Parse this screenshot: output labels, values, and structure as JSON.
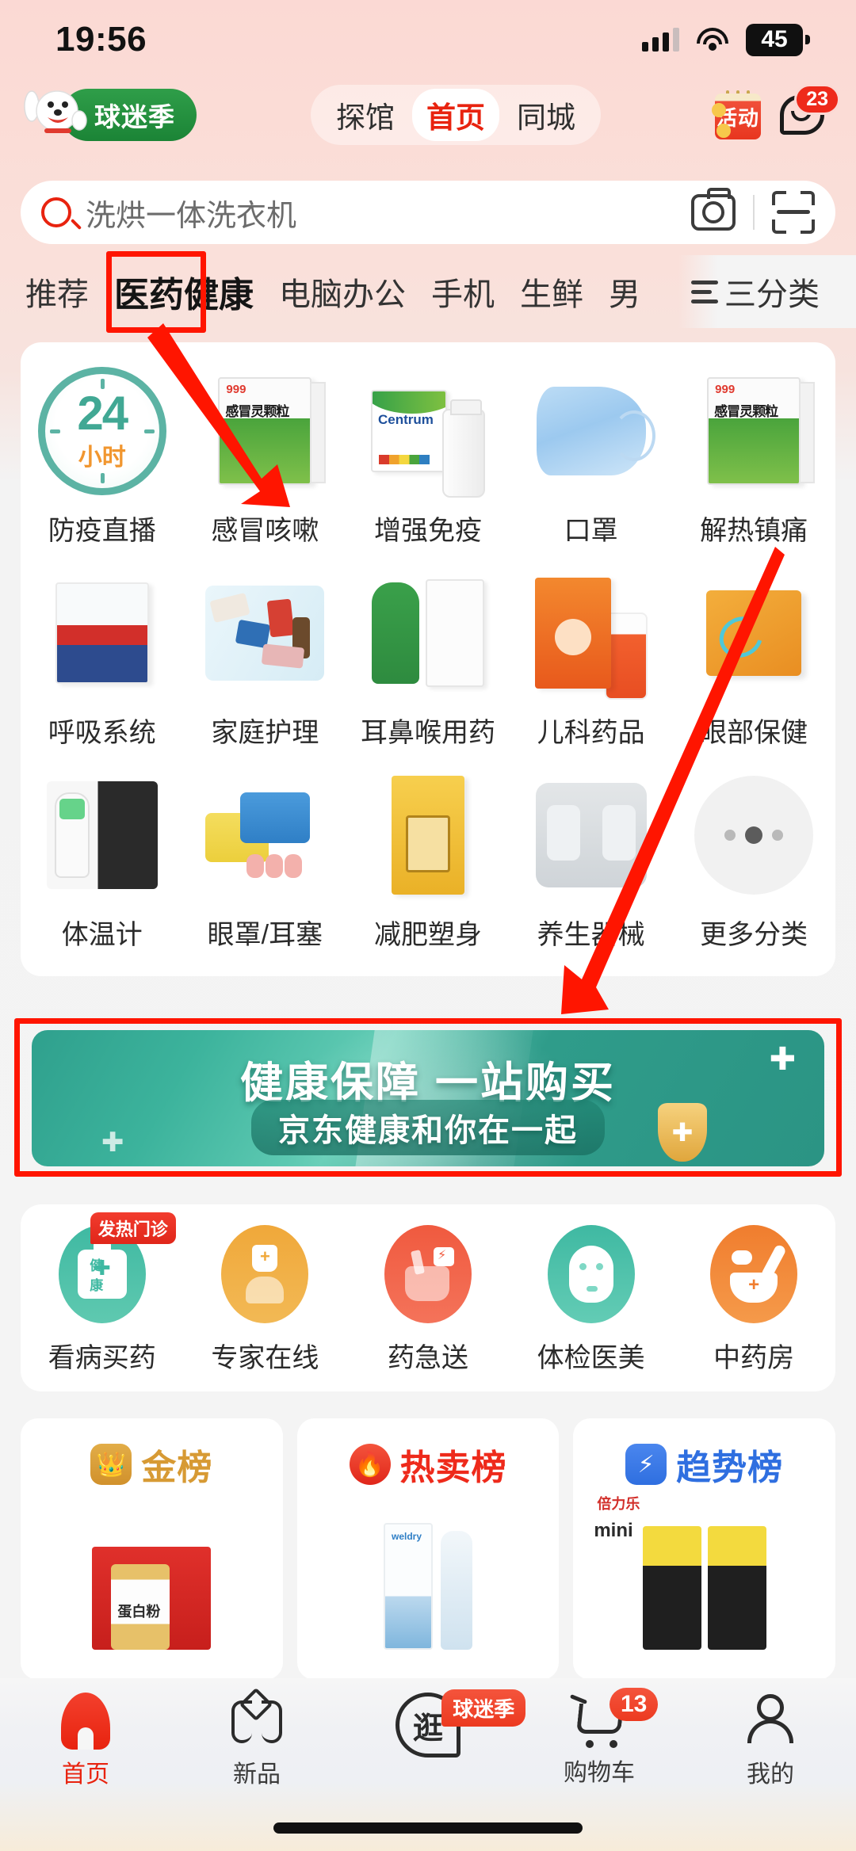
{
  "status_bar": {
    "time": "19:56",
    "battery": "45",
    "wifi_icon": "wifi-icon",
    "signal_icon": "signal-bars-icon"
  },
  "header": {
    "logo_text": "球迷季",
    "logo_icon": "jd-dog-mascot-icon",
    "tabs": [
      {
        "label": "探馆",
        "active": false
      },
      {
        "label": "首页",
        "active": true
      },
      {
        "label": "同城",
        "active": false
      }
    ],
    "activity_icon_label": "活动",
    "message_icon": "message-bubble-icon",
    "message_badge": "23"
  },
  "search": {
    "value": "洗烘一体洗衣机",
    "placeholder": "洗烘一体洗衣机",
    "search_icon": "search-icon",
    "camera_icon": "camera-icon",
    "scan_icon": "scan-barcode-icon"
  },
  "category_tabs": {
    "items": [
      {
        "label": "推荐",
        "selected": false
      },
      {
        "label": "医药健康",
        "selected": true
      },
      {
        "label": "电脑办公",
        "selected": false
      },
      {
        "label": "手机",
        "selected": false
      },
      {
        "label": "生鲜",
        "selected": false
      },
      {
        "label": "男",
        "selected": false
      }
    ],
    "menu_label": "三分类",
    "menu_icon": "hamburger-menu-icon"
  },
  "icon_grid": {
    "rows": [
      [
        {
          "label": "防疫直播",
          "art": "clock24"
        },
        {
          "label": "感冒咳嗽",
          "art": "box999"
        },
        {
          "label": "增强免疫",
          "art": "centrum"
        },
        {
          "label": "口罩",
          "art": "mask"
        },
        {
          "label": "解热镇痛",
          "art": "box999b"
        }
      ],
      [
        {
          "label": "呼吸系统",
          "art": "boxTeal"
        },
        {
          "label": "家庭护理",
          "art": "kit"
        },
        {
          "label": "耳鼻喉用药",
          "art": "spray"
        },
        {
          "label": "儿科药品",
          "art": "syrup"
        },
        {
          "label": "眼部保健",
          "art": "goldBox"
        }
      ],
      [
        {
          "label": "体温计",
          "art": "thermo"
        },
        {
          "label": "眼罩/耳塞",
          "art": "earplug"
        },
        {
          "label": "减肥塑身",
          "art": "yellowBox"
        },
        {
          "label": "养生器械",
          "art": "brace"
        },
        {
          "label": "更多分类",
          "art": "moreDots"
        }
      ]
    ]
  },
  "banner": {
    "line1": "健康保障 一站购买",
    "line2": "京东健康和你在一起",
    "plus_icon": "medical-cross-icon",
    "shield_icon": "gold-shield-icon",
    "bg_color": "#2f9c8a"
  },
  "services": [
    {
      "label": "看病买药",
      "badge": "发热门诊",
      "color": "#3fb9a2",
      "icon": "health-bag-icon"
    },
    {
      "label": "专家在线",
      "badge": "",
      "color": "#f0a83a",
      "icon": "doctor-icon"
    },
    {
      "label": "药急送",
      "badge": "",
      "color": "#f05a3f",
      "icon": "fast-delivery-flask-icon"
    },
    {
      "label": "体检医美",
      "badge": "",
      "color": "#3fb9a2",
      "icon": "face-mask-icon"
    },
    {
      "label": "中药房",
      "badge": "",
      "color": "#f07d2e",
      "icon": "mortar-pestle-icon"
    }
  ],
  "rank_cards": [
    {
      "title": "金榜",
      "badge_icon": "crown-badge-icon",
      "color": "#d79a34",
      "product": "蛋白粉礼盒"
    },
    {
      "title": "热卖榜",
      "badge_icon": "flame-badge-icon",
      "color": "#ee2a1b",
      "product": "便携式氧气呼吸器"
    },
    {
      "title": "趋势榜",
      "badge_icon": "lightning-badge-icon",
      "color": "#2f6fe0",
      "product": "mini 倍力乐"
    }
  ],
  "bottom_nav": [
    {
      "label": "首页",
      "active": true,
      "icon": "home-icon",
      "badge": ""
    },
    {
      "label": "新品",
      "active": false,
      "icon": "new-products-icon",
      "badge": ""
    },
    {
      "label": "逛",
      "active": false,
      "icon": "discover-icon",
      "badge": "球迷季"
    },
    {
      "label": "购物车",
      "active": false,
      "icon": "shopping-cart-icon",
      "badge": "13"
    },
    {
      "label": "我的",
      "active": false,
      "icon": "user-profile-icon",
      "badge": ""
    }
  ],
  "annotations": {
    "highlight_color": "#ff1500",
    "boxes": [
      {
        "name": "category-tab-highlight",
        "target": "医药健康"
      },
      {
        "name": "banner-highlight",
        "target": "健康保障 一站购买"
      }
    ],
    "arrows": [
      {
        "name": "arrow-to-category-tab"
      },
      {
        "name": "arrow-to-banner"
      }
    ]
  }
}
